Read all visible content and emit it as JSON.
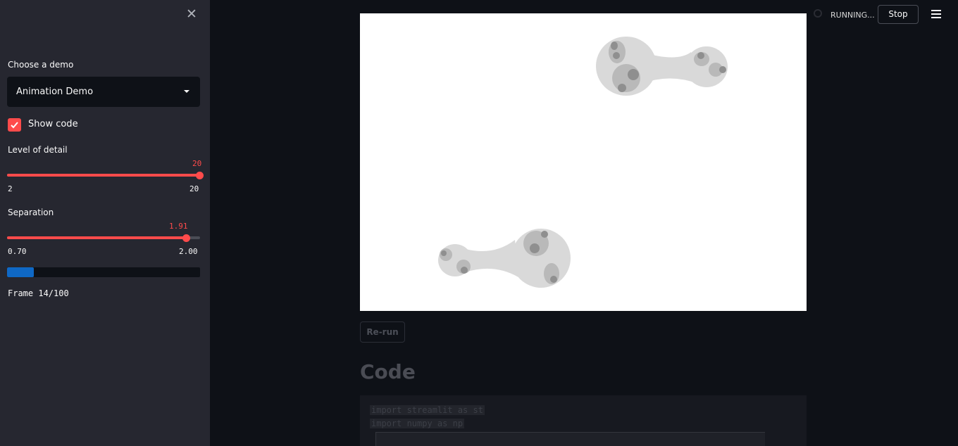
{
  "sidebar": {
    "close_icon": "close-icon",
    "demo_select": {
      "label": "Choose a demo",
      "value": "Animation Demo"
    },
    "show_code": {
      "label": "Show code",
      "checked": true
    },
    "detail_slider": {
      "label": "Level of detail",
      "value": "20",
      "min": "2",
      "max": "20",
      "fraction": 1.0
    },
    "separation_slider": {
      "label": "Separation",
      "value": "1.91",
      "min": "0.70",
      "max": "2.00",
      "fraction": 0.93
    },
    "progress": {
      "fraction": 0.14
    },
    "frame_text": "Frame 14/100"
  },
  "header": {
    "status_text": "RUNNING...",
    "stop_label": "Stop",
    "menu_icon": "hamburger-menu-icon"
  },
  "main": {
    "rerun_label": "Re-run",
    "code_heading": "Code",
    "code_lines": [
      "import streamlit as st",
      "import numpy as np"
    ]
  },
  "colors": {
    "accent": "#ff4b4b",
    "progress": "#0f68c5",
    "sidebar_bg": "#262730",
    "app_bg": "#0e1117"
  }
}
